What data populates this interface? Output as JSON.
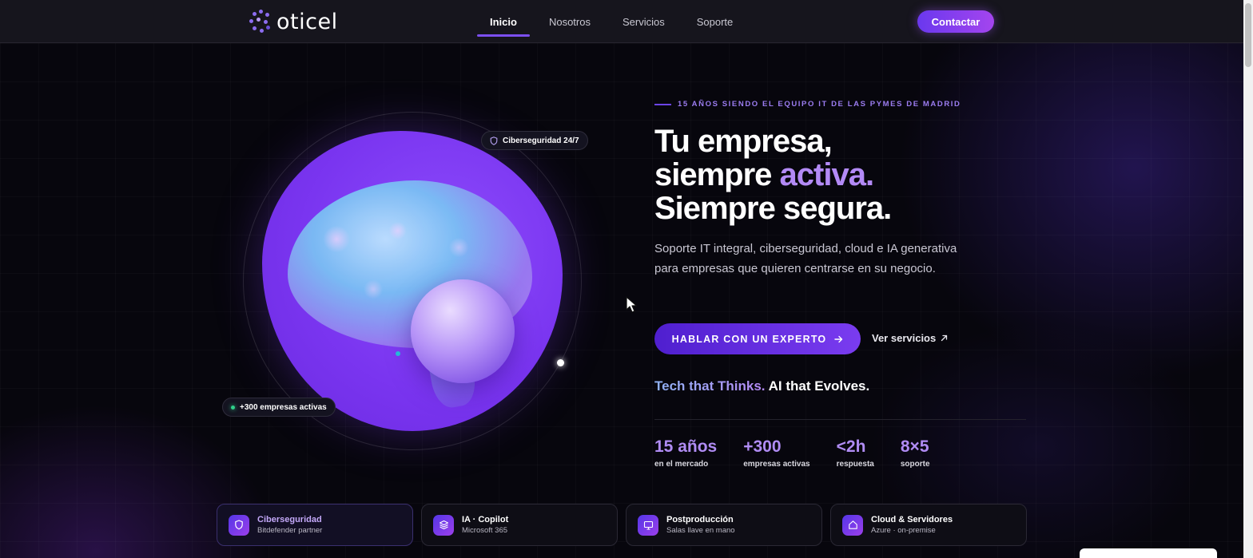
{
  "header": {
    "logo_text": "oticel",
    "nav": [
      {
        "label": "Inicio",
        "active": true
      },
      {
        "label": "Nosotros",
        "active": false
      },
      {
        "label": "Servicios",
        "active": false
      },
      {
        "label": "Soporte",
        "active": false
      }
    ],
    "contact_label": "Contactar"
  },
  "hero": {
    "badge_top": "Ciberseguridad 24/7",
    "badge_bottom": "+300 empresas activas",
    "eyebrow": "15 AÑOS SIENDO EL EQUIPO IT DE LAS PYMES DE MADRID",
    "title_line1": "Tu empresa,",
    "title_line2_a": "siempre ",
    "title_line2_b": "activa.",
    "title_line3": "Siempre segura.",
    "lead": "Soporte IT integral, ciberseguridad, cloud e IA generativa para empresas que quieren centrarse en su negocio.",
    "cta_primary": "HABLAR CON UN EXPERTO",
    "cta_secondary": "Ver servicios",
    "tagline_a": "Tech that Thinks.",
    "tagline_b": " AI that Evolves."
  },
  "stats": [
    {
      "value": "15 años",
      "label": "en el mercado"
    },
    {
      "value": "+300",
      "label": "empresas activas"
    },
    {
      "value": "<2h",
      "label": "respuesta"
    },
    {
      "value": "8×5",
      "label": "soporte"
    }
  ],
  "services": [
    {
      "title": "Ciberseguridad",
      "subtitle": "Bitdefender partner",
      "icon": "shield-icon",
      "active": true
    },
    {
      "title": "IA · Copilot",
      "subtitle": "Microsoft 365",
      "icon": "layers-icon",
      "active": false
    },
    {
      "title": "Postproducción",
      "subtitle": "Salas llave en mano",
      "icon": "monitor-icon",
      "active": false
    },
    {
      "title": "Cloud & Servidores",
      "subtitle": "Azure · on-premise",
      "icon": "home-icon",
      "active": false
    }
  ],
  "colors": {
    "accent": "#7c4ff0",
    "accent_light": "#b38af6",
    "background": "#07060d",
    "status_green": "#2fd08a"
  }
}
